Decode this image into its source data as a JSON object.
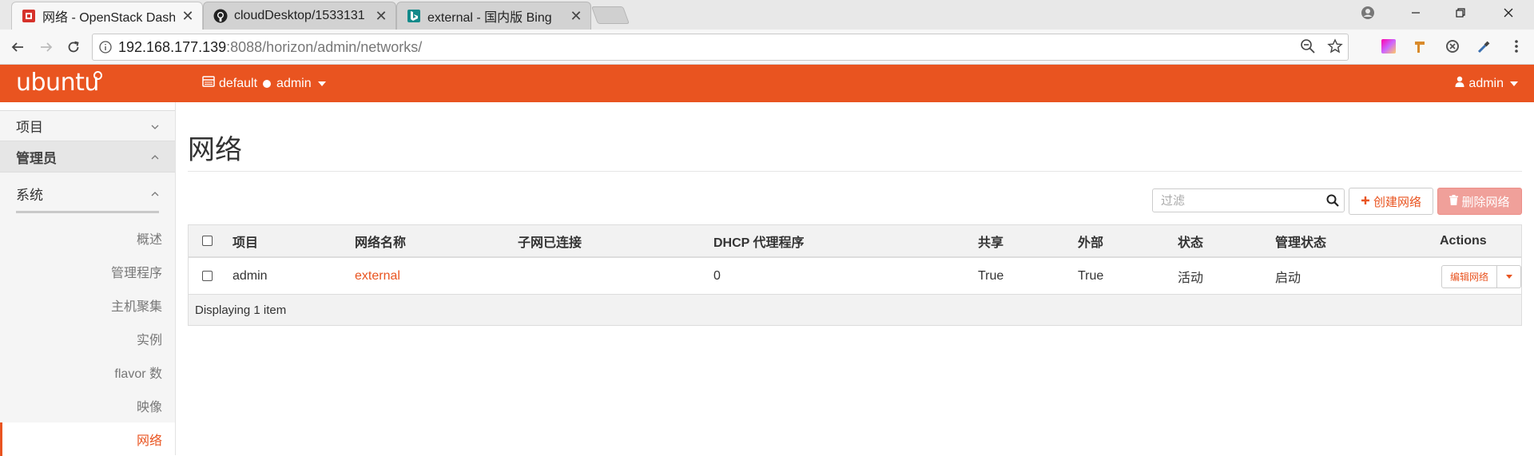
{
  "browser": {
    "tabs": [
      {
        "title": "网络 - OpenStack Dashb",
        "close": "✕",
        "active": true
      },
      {
        "title": "cloudDesktop/1533131",
        "close": "✕",
        "active": false
      },
      {
        "title": "external - 国内版 Bing",
        "close": "✕",
        "active": false
      }
    ],
    "url_host": "192.168.177.139",
    "url_rest": ":8088/horizon/admin/networks/"
  },
  "header": {
    "logo": "ubuntu",
    "domain": "default",
    "project": "admin",
    "user": "admin",
    "brand_color": "#e95420"
  },
  "sidebar": {
    "project": "项目",
    "admin": "管理员",
    "system": "系统",
    "items": [
      "概述",
      "管理程序",
      "主机聚集",
      "实例",
      "flavor 数",
      "映像",
      "网络"
    ],
    "active_index": 6
  },
  "main": {
    "title": "网络",
    "filter_placeholder": "过滤",
    "create_label": "创建网络",
    "delete_label": "删除网络",
    "columns": [
      "项目",
      "网络名称",
      "子网已连接",
      "DHCP 代理程序",
      "共享",
      "外部",
      "状态",
      "管理状态",
      "Actions"
    ],
    "rows": [
      {
        "project": "admin",
        "name": "external",
        "subnets": "",
        "dhcp": "0",
        "shared": "True",
        "external": "True",
        "status": "活动",
        "admin_state": "启动",
        "action": "编辑网络"
      }
    ],
    "footer": "Displaying 1 item"
  }
}
